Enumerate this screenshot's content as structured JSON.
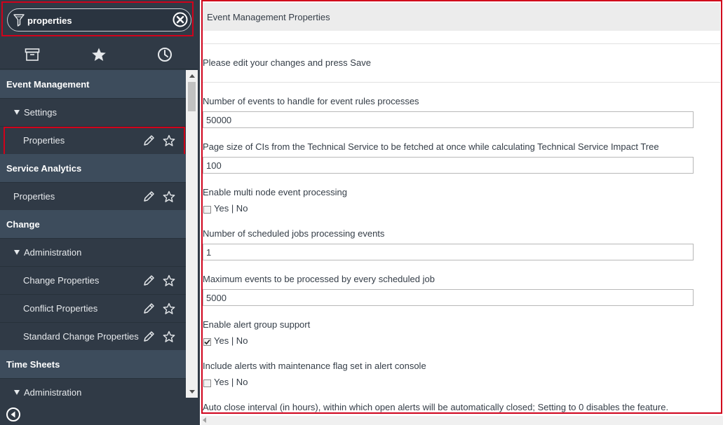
{
  "filter": {
    "value": "properties"
  },
  "nav_tabs": [
    "all-apps",
    "favorites",
    "history"
  ],
  "nav": {
    "rows": [
      {
        "type": "section",
        "label": "Event Management"
      },
      {
        "type": "group",
        "label": "Settings"
      },
      {
        "type": "item",
        "label": "Properties",
        "level": 2,
        "highlighted": true
      },
      {
        "type": "section",
        "label": "Service Analytics"
      },
      {
        "type": "item",
        "label": "Properties",
        "level": 1
      },
      {
        "type": "section",
        "label": "Change"
      },
      {
        "type": "group",
        "label": "Administration"
      },
      {
        "type": "item",
        "label": "Change Properties",
        "level": 2
      },
      {
        "type": "item",
        "label": "Conflict Properties",
        "level": 2
      },
      {
        "type": "item",
        "label": "Standard Change Properties",
        "level": 2
      },
      {
        "type": "section",
        "label": "Time Sheets"
      },
      {
        "type": "group",
        "label": "Administration"
      }
    ]
  },
  "main": {
    "title": "Event Management Properties",
    "instructions": "Please edit your changes and press Save",
    "properties": [
      {
        "label": "Number of events to handle for event rules processes",
        "kind": "text",
        "value": "50000"
      },
      {
        "label": "Page size of CIs from the Technical Service to be fetched at once while calculating Technical Service Impact Tree",
        "kind": "text",
        "value": "100"
      },
      {
        "label": "Enable multi node event processing",
        "kind": "checkbox",
        "checked": false,
        "option_text": "Yes | No"
      },
      {
        "label": "Number of scheduled jobs processing events",
        "kind": "text",
        "value": "1"
      },
      {
        "label": "Maximum events to be processed by every scheduled job",
        "kind": "text",
        "value": "5000"
      },
      {
        "label": "Enable alert group support",
        "kind": "checkbox",
        "checked": true,
        "option_text": "Yes | No"
      },
      {
        "label": "Include alerts with maintenance flag set in alert console",
        "kind": "checkbox",
        "checked": false,
        "option_text": "Yes | No"
      },
      {
        "label": "Auto close interval (in hours), within which open alerts will be automatically closed; Setting to 0 disables the feature.",
        "kind": "text",
        "value": ""
      }
    ]
  },
  "colors": {
    "sidebar_bg": "#303a46",
    "section_bg": "#3d4c5c",
    "highlight": "#d0021b",
    "header_bg": "#ececec"
  }
}
